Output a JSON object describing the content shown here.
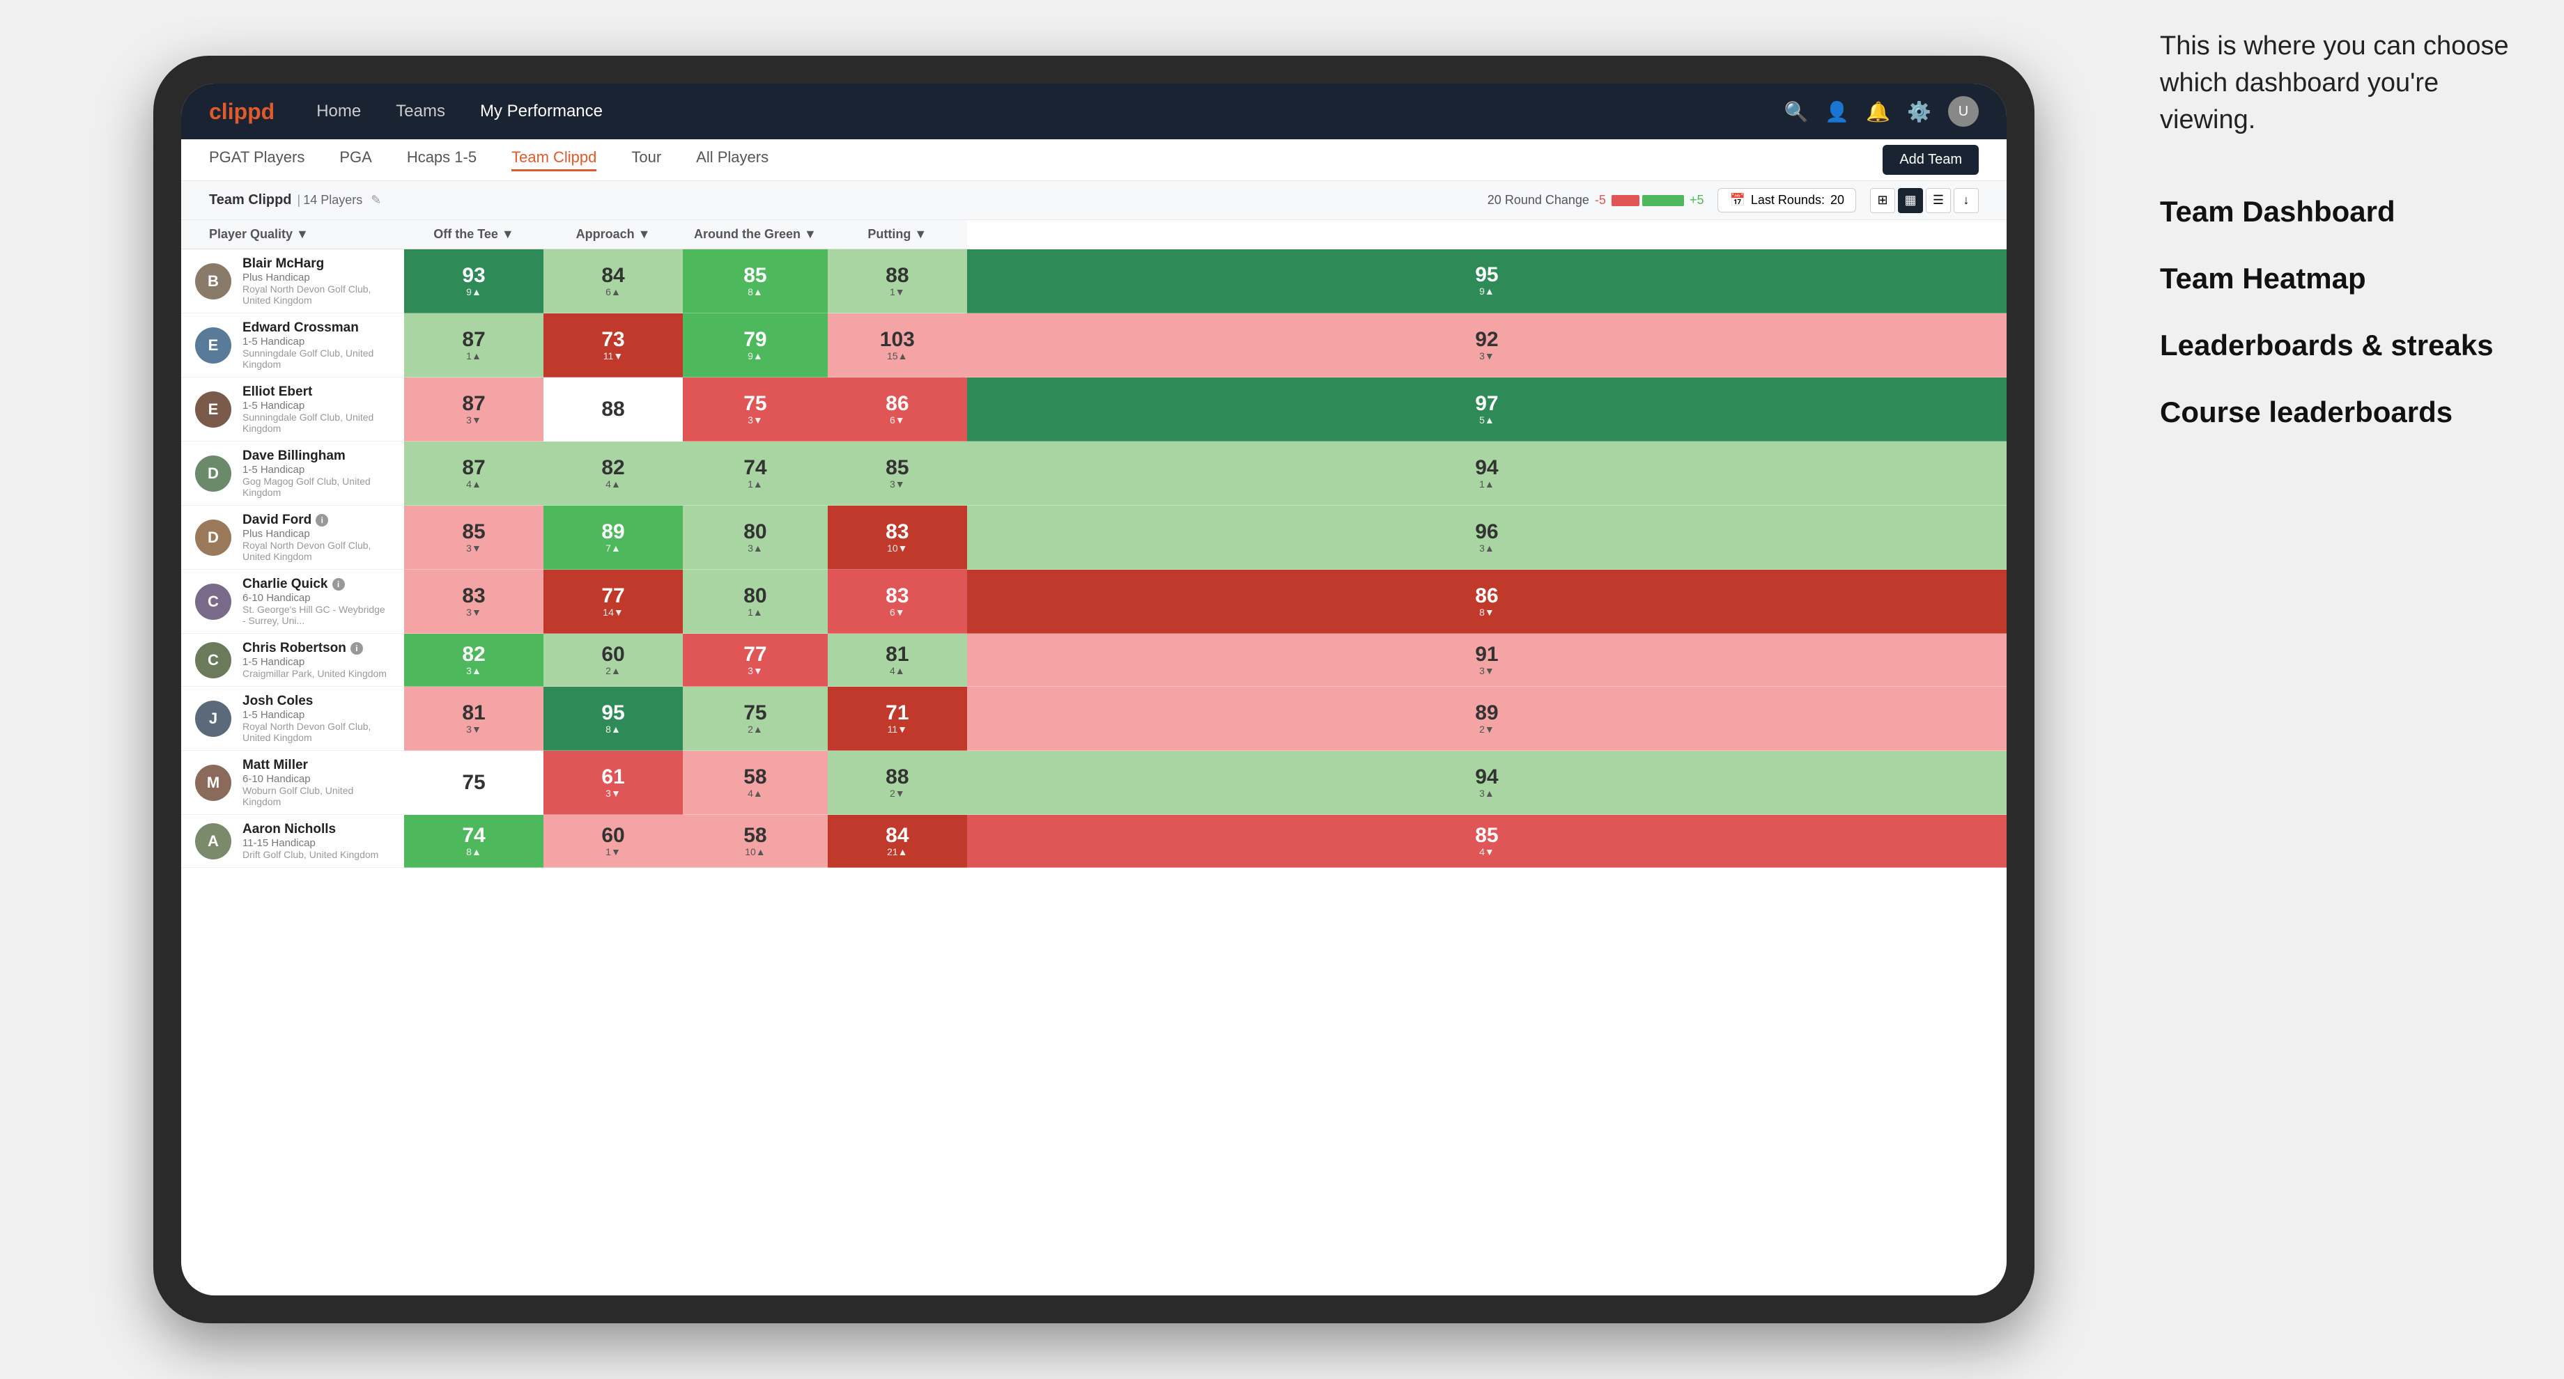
{
  "annotation": {
    "intro": "This is where you can choose which dashboard you're viewing.",
    "options": [
      "Team Dashboard",
      "Team Heatmap",
      "Leaderboards & streaks",
      "Course leaderboards"
    ]
  },
  "navbar": {
    "logo": "clippd",
    "links": [
      "Home",
      "Teams",
      "My Performance"
    ],
    "active_link": "My Performance"
  },
  "subnav": {
    "links": [
      "PGAT Players",
      "PGA",
      "Hcaps 1-5",
      "Team Clippd",
      "Tour",
      "All Players"
    ],
    "active_link": "Team Clippd",
    "add_team_label": "Add Team"
  },
  "team_header": {
    "name": "Team Clippd",
    "separator": "|",
    "count": "14 Players",
    "round_change_label": "20 Round Change",
    "change_neg": "-5",
    "change_pos": "+5",
    "last_rounds_label": "Last Rounds:",
    "last_rounds_value": "20"
  },
  "table": {
    "columns": [
      {
        "id": "player",
        "label": "Player Quality ▼"
      },
      {
        "id": "tee",
        "label": "Off the Tee ▼"
      },
      {
        "id": "approach",
        "label": "Approach ▼"
      },
      {
        "id": "around",
        "label": "Around the Green ▼"
      },
      {
        "id": "putting",
        "label": "Putting ▼"
      }
    ],
    "rows": [
      {
        "name": "Blair McHarg",
        "handicap": "Plus Handicap",
        "club": "Royal North Devon Golf Club, United Kingdom",
        "avatar_color": "#8a7a6a",
        "avatar_letter": "B",
        "scores": [
          {
            "value": "93",
            "change": "9",
            "dir": "up",
            "bg": "green-dark"
          },
          {
            "value": "84",
            "change": "6",
            "dir": "up",
            "bg": "green-light"
          },
          {
            "value": "85",
            "change": "8",
            "dir": "up",
            "bg": "green-mid"
          },
          {
            "value": "88",
            "change": "1",
            "dir": "down",
            "bg": "green-light"
          },
          {
            "value": "95",
            "change": "9",
            "dir": "up",
            "bg": "green-dark"
          }
        ]
      },
      {
        "name": "Edward Crossman",
        "handicap": "1-5 Handicap",
        "club": "Sunningdale Golf Club, United Kingdom",
        "avatar_color": "#5a7a9a",
        "avatar_letter": "E",
        "scores": [
          {
            "value": "87",
            "change": "1",
            "dir": "up",
            "bg": "green-light"
          },
          {
            "value": "73",
            "change": "11",
            "dir": "down",
            "bg": "red-dark"
          },
          {
            "value": "79",
            "change": "9",
            "dir": "up",
            "bg": "green-mid"
          },
          {
            "value": "103",
            "change": "15",
            "dir": "up",
            "bg": "red-light"
          },
          {
            "value": "92",
            "change": "3",
            "dir": "down",
            "bg": "red-light"
          }
        ]
      },
      {
        "name": "Elliot Ebert",
        "handicap": "1-5 Handicap",
        "club": "Sunningdale Golf Club, United Kingdom",
        "avatar_color": "#7a5a4a",
        "avatar_letter": "E",
        "scores": [
          {
            "value": "87",
            "change": "3",
            "dir": "down",
            "bg": "red-light"
          },
          {
            "value": "88",
            "change": "",
            "dir": "",
            "bg": "white"
          },
          {
            "value": "75",
            "change": "3",
            "dir": "down",
            "bg": "red-mid"
          },
          {
            "value": "86",
            "change": "6",
            "dir": "down",
            "bg": "red-mid"
          },
          {
            "value": "97",
            "change": "5",
            "dir": "up",
            "bg": "green-dark"
          }
        ]
      },
      {
        "name": "Dave Billingham",
        "handicap": "1-5 Handicap",
        "club": "Gog Magog Golf Club, United Kingdom",
        "avatar_color": "#6a8a6a",
        "avatar_letter": "D",
        "scores": [
          {
            "value": "87",
            "change": "4",
            "dir": "up",
            "bg": "green-light"
          },
          {
            "value": "82",
            "change": "4",
            "dir": "up",
            "bg": "green-light"
          },
          {
            "value": "74",
            "change": "1",
            "dir": "up",
            "bg": "green-light"
          },
          {
            "value": "85",
            "change": "3",
            "dir": "down",
            "bg": "green-light"
          },
          {
            "value": "94",
            "change": "1",
            "dir": "up",
            "bg": "green-light"
          }
        ]
      },
      {
        "name": "David Ford",
        "handicap": "Plus Handicap",
        "club": "Royal North Devon Golf Club, United Kingdom",
        "avatar_color": "#9a7a5a",
        "avatar_letter": "D",
        "has_info": true,
        "scores": [
          {
            "value": "85",
            "change": "3",
            "dir": "down",
            "bg": "red-light"
          },
          {
            "value": "89",
            "change": "7",
            "dir": "up",
            "bg": "green-mid"
          },
          {
            "value": "80",
            "change": "3",
            "dir": "up",
            "bg": "green-light"
          },
          {
            "value": "83",
            "change": "10",
            "dir": "down",
            "bg": "red-dark"
          },
          {
            "value": "96",
            "change": "3",
            "dir": "up",
            "bg": "green-light"
          }
        ]
      },
      {
        "name": "Charlie Quick",
        "handicap": "6-10 Handicap",
        "club": "St. George's Hill GC - Weybridge - Surrey, Uni...",
        "avatar_color": "#7a6a8a",
        "avatar_letter": "C",
        "has_info": true,
        "scores": [
          {
            "value": "83",
            "change": "3",
            "dir": "down",
            "bg": "red-light"
          },
          {
            "value": "77",
            "change": "14",
            "dir": "down",
            "bg": "red-dark"
          },
          {
            "value": "80",
            "change": "1",
            "dir": "up",
            "bg": "green-light"
          },
          {
            "value": "83",
            "change": "6",
            "dir": "down",
            "bg": "red-mid"
          },
          {
            "value": "86",
            "change": "8",
            "dir": "down",
            "bg": "red-dark"
          }
        ]
      },
      {
        "name": "Chris Robertson",
        "handicap": "1-5 Handicap",
        "club": "Craigmillar Park, United Kingdom",
        "avatar_color": "#6a7a5a",
        "avatar_letter": "C",
        "has_info": true,
        "scores": [
          {
            "value": "82",
            "change": "3",
            "dir": "up",
            "bg": "green-mid"
          },
          {
            "value": "60",
            "change": "2",
            "dir": "up",
            "bg": "green-light"
          },
          {
            "value": "77",
            "change": "3",
            "dir": "down",
            "bg": "red-mid"
          },
          {
            "value": "81",
            "change": "4",
            "dir": "up",
            "bg": "green-light"
          },
          {
            "value": "91",
            "change": "3",
            "dir": "down",
            "bg": "red-light"
          }
        ]
      },
      {
        "name": "Josh Coles",
        "handicap": "1-5 Handicap",
        "club": "Royal North Devon Golf Club, United Kingdom",
        "avatar_color": "#5a6a7a",
        "avatar_letter": "J",
        "scores": [
          {
            "value": "81",
            "change": "3",
            "dir": "down",
            "bg": "red-light"
          },
          {
            "value": "95",
            "change": "8",
            "dir": "up",
            "bg": "green-dark"
          },
          {
            "value": "75",
            "change": "2",
            "dir": "up",
            "bg": "green-light"
          },
          {
            "value": "71",
            "change": "11",
            "dir": "down",
            "bg": "red-dark"
          },
          {
            "value": "89",
            "change": "2",
            "dir": "down",
            "bg": "red-light"
          }
        ]
      },
      {
        "name": "Matt Miller",
        "handicap": "6-10 Handicap",
        "club": "Woburn Golf Club, United Kingdom",
        "avatar_color": "#8a6a5a",
        "avatar_letter": "M",
        "scores": [
          {
            "value": "75",
            "change": "",
            "dir": "",
            "bg": "white"
          },
          {
            "value": "61",
            "change": "3",
            "dir": "down",
            "bg": "red-mid"
          },
          {
            "value": "58",
            "change": "4",
            "dir": "up",
            "bg": "red-light"
          },
          {
            "value": "88",
            "change": "2",
            "dir": "down",
            "bg": "green-light"
          },
          {
            "value": "94",
            "change": "3",
            "dir": "up",
            "bg": "green-light"
          }
        ]
      },
      {
        "name": "Aaron Nicholls",
        "handicap": "11-15 Handicap",
        "club": "Drift Golf Club, United Kingdom",
        "avatar_color": "#7a8a6a",
        "avatar_letter": "A",
        "scores": [
          {
            "value": "74",
            "change": "8",
            "dir": "up",
            "bg": "green-mid"
          },
          {
            "value": "60",
            "change": "1",
            "dir": "down",
            "bg": "red-light"
          },
          {
            "value": "58",
            "change": "10",
            "dir": "up",
            "bg": "red-light"
          },
          {
            "value": "84",
            "change": "21",
            "dir": "up",
            "bg": "red-dark"
          },
          {
            "value": "85",
            "change": "4",
            "dir": "down",
            "bg": "red-mid"
          }
        ]
      }
    ]
  }
}
